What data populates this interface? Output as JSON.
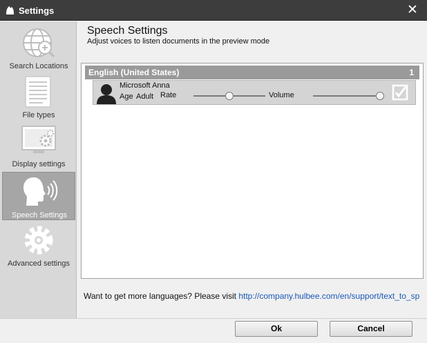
{
  "window": {
    "title": "Settings",
    "title_icon": "app-logo-icon",
    "close_glyph": "✕"
  },
  "sidebar": {
    "items": [
      {
        "label": "Search Locations",
        "icon": "globe-search-icon",
        "active": false
      },
      {
        "label": "File types",
        "icon": "document-icon",
        "active": false
      },
      {
        "label": "Display settings",
        "icon": "display-gear-icon",
        "active": false
      },
      {
        "label": "Speech Settings",
        "icon": "speaking-head-icon",
        "active": true
      },
      {
        "label": "Advanced settings",
        "icon": "gear-icon",
        "active": false
      }
    ]
  },
  "main": {
    "heading": "Speech Settings",
    "subheading": "Adjust voices to listen documents in the preview mode",
    "language_group": {
      "name": "English (United States)",
      "count": "1"
    },
    "voice": {
      "name": "Microsoft Anna",
      "age_label": "Age",
      "age_value": "Adult",
      "rate_label": "Rate",
      "rate_level": 0.5,
      "volume_label": "Volume",
      "volume_level": 0.95,
      "enabled": true,
      "avatar_icon": "person-silhouette-icon"
    },
    "more_languages_text": "Want to get more languages? Please visit ",
    "more_languages_link": "http://company.hulbee.com/en/support/text_to_sp"
  },
  "footer": {
    "ok_label": "Ok",
    "cancel_label": "Cancel"
  },
  "colors": {
    "titlebar": "#3d3d3d",
    "sidebar": "#d8d8d8",
    "active_item": "#a6a6a6",
    "group_header": "#9a9a9a",
    "link": "#1c58b8"
  }
}
